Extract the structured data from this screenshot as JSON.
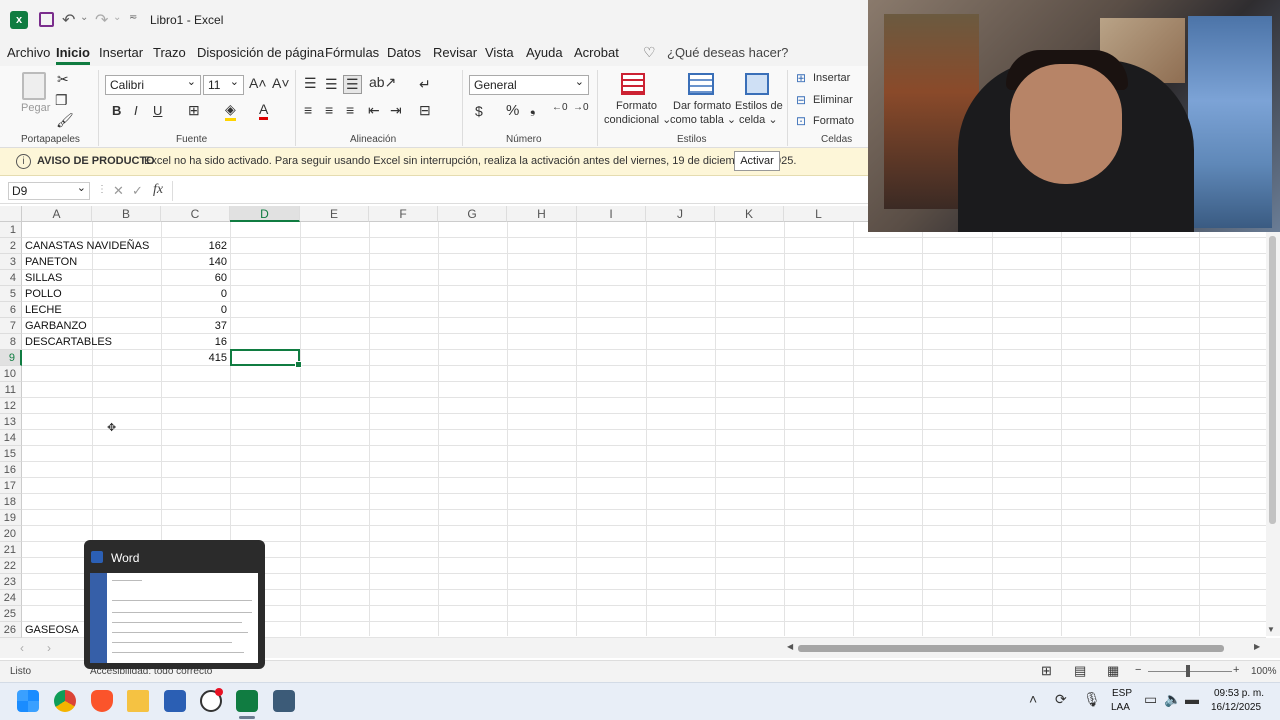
{
  "window": {
    "title": "Libro1  -  Excel"
  },
  "menu": {
    "tabs": [
      "Archivo",
      "Inicio",
      "Insertar",
      "Trazo",
      "Disposición de página",
      "Fórmulas",
      "Datos",
      "Revisar",
      "Vista",
      "Ayuda",
      "Acrobat"
    ],
    "search_placeholder": "¿Qué deseas hacer?"
  },
  "ribbon": {
    "clipboard": {
      "paste_label": "Pegar",
      "group": "Portapapeles"
    },
    "font": {
      "name": "Calibri",
      "size": "11",
      "group": "Fuente",
      "bold": "B",
      "italic": "I",
      "underline": "U"
    },
    "alignment": {
      "group": "Alineación"
    },
    "number": {
      "format": "General",
      "group": "Número",
      "currency": "$",
      "percent": "%"
    },
    "styles": {
      "group": "Estilos",
      "conditional_l1": "Formato",
      "conditional_l2": "condicional ⌄",
      "table_l1": "Dar formato",
      "table_l2": "como tabla ⌄",
      "cellstyles_l1": "Estilos de",
      "cellstyles_l2": "celda ⌄"
    },
    "cells": {
      "group": "Celdas",
      "insert": "Insertar",
      "delete": "Eliminar",
      "format": "Formato"
    }
  },
  "banner": {
    "title": "AVISO DE PRODUCTO",
    "message": "Excel no ha sido activado. Para seguir usando Excel sin interrupción, realiza la activación antes del viernes, 19 de diciembre de 2025.",
    "button": "Activar"
  },
  "formula_bar": {
    "name_box": "D9",
    "fx": "fx",
    "cancel": "✕",
    "enter": "✓",
    "value": ""
  },
  "sheet": {
    "columns": [
      "A",
      "B",
      "C",
      "D",
      "E",
      "F",
      "G",
      "H",
      "I",
      "J",
      "K",
      "L"
    ],
    "rows": [
      "1",
      "2",
      "3",
      "4",
      "5",
      "6",
      "7",
      "8",
      "9",
      "10",
      "11",
      "12",
      "13",
      "14",
      "15",
      "16",
      "17",
      "18",
      "19",
      "20",
      "21",
      "22",
      "23",
      "24",
      "25",
      "26"
    ],
    "selected_cell": "D9",
    "cells": {
      "A2": "CANASTAS NAVIDEÑAS",
      "C2": "162",
      "A3": "PANETON",
      "C3": "140",
      "A4": "SILLAS",
      "C4": "60",
      "A5": "POLLO",
      "C5": "0",
      "A6": "LECHE",
      "C6": "0",
      "A7": "GARBANZO",
      "C7": "37",
      "A8": "DESCARTABLES",
      "C8": "16",
      "C9": "415",
      "A26": "GASEOSA"
    }
  },
  "status_bar": {
    "ready": "Listo",
    "accessibility": "Accesibilidad: todo correcto",
    "zoom": "100%",
    "zoom_minus": "−",
    "zoom_plus": "+"
  },
  "taskbar_preview": {
    "title": "Word"
  },
  "taskbar": {
    "lang_line1": "ESP",
    "lang_line2": "LAA",
    "time": "09:53 p. m.",
    "date": "16/12/2025"
  },
  "colors": {
    "accent": "#107c41",
    "banner_bg": "#fdf6d8",
    "taskbar_bg": "#e8eef7"
  }
}
